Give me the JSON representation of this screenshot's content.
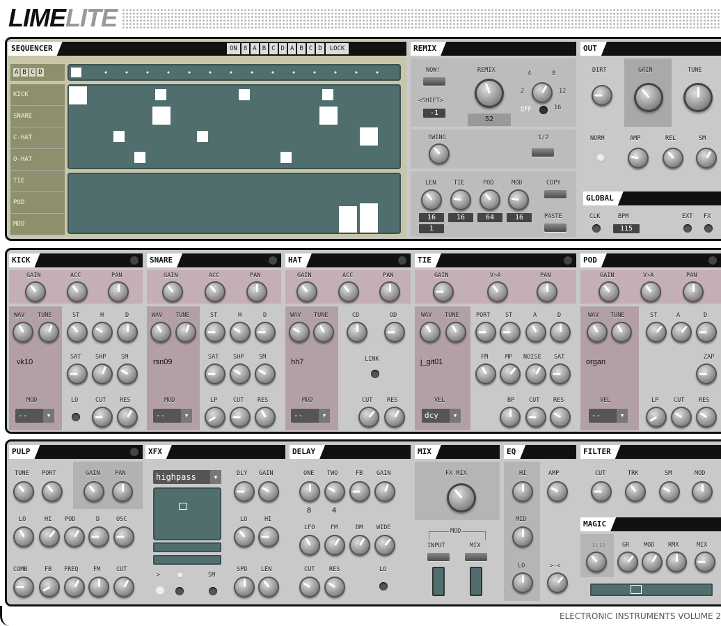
{
  "logo": {
    "lime": "LIME",
    "lite": "LITE"
  },
  "footer": "ELECTRONIC INSTRUMENTS VOLUME 2",
  "sequencer": {
    "title": "SEQUENCER",
    "buttons": [
      "ON",
      "8",
      "A",
      "B",
      "C",
      "D",
      "A",
      "B",
      "C",
      "D",
      "LOCK"
    ],
    "patterns": [
      "A",
      "B",
      "C",
      "D"
    ],
    "rows": [
      "KICK",
      "SNARE",
      "C-HAT",
      "O-HAT",
      "TIE",
      "POD",
      "MOD"
    ]
  },
  "remix": {
    "title": "REMIX",
    "now": "NOW!",
    "shift": "<SHIFT>",
    "shift_val": "-1",
    "remix": "REMIX",
    "remix_val": "52",
    "steps": [
      "4",
      "8",
      "2",
      "12",
      "OFF",
      "16"
    ],
    "swing": "SWING",
    "half": "1/2",
    "len": "LEN",
    "tie": "TIE",
    "pod": "POD",
    "mod": "MOD",
    "copy": "COPY",
    "paste": "PASTE",
    "len_val": "16",
    "tie_val": "16",
    "pod_val": "64",
    "mod_val": "16",
    "len_val2": "1"
  },
  "out": {
    "title": "OUT",
    "dirt": "DIRT",
    "gain": "GAIN",
    "tune": "TUNE",
    "norm": "NORM",
    "amp": "AMP",
    "rel": "REL",
    "sm": "SM"
  },
  "global": {
    "title": "GLOBAL",
    "clk": "CLK",
    "bpm": "BPM",
    "bpm_val": "115",
    "ext": "EXT",
    "fx": "FX"
  },
  "kick": {
    "title": "KICK",
    "gain": "GAIN",
    "acc": "ACC",
    "pan": "PAN",
    "wav": "WAV",
    "tune": "TUNE",
    "st": "ST",
    "h": "H",
    "d": "D",
    "sample": "vk10",
    "sat": "SAT",
    "shp": "SHP",
    "sm": "SM",
    "mod": "MOD",
    "lo": "LO",
    "cut": "CUT",
    "res": "RES",
    "mod_val": "--"
  },
  "snare": {
    "title": "SNARE",
    "gain": "GAIN",
    "acc": "ACC",
    "pan": "PAN",
    "wav": "WAV",
    "tune": "TUNE",
    "st": "ST",
    "h": "H",
    "d": "D",
    "sample": "rsn09",
    "sat": "SAT",
    "shp": "SHP",
    "sm": "SM",
    "mod": "MOD",
    "lp": "LP",
    "cut": "CUT",
    "res": "RES",
    "mod_val": "--"
  },
  "hat": {
    "title": "HAT",
    "gain": "GAIN",
    "acc": "ACC",
    "pan": "PAN",
    "wav": "WAV",
    "tune": "TUNE",
    "cd": "CD",
    "od": "OD",
    "sample": "hh7",
    "link": "LINK",
    "mod": "MOD",
    "cut": "CUT",
    "res": "RES",
    "mod_val": "--"
  },
  "tie": {
    "title": "TIE",
    "gain": "GAIN",
    "vta": "V>A",
    "pan": "PAN",
    "wav": "WAV",
    "tune": "TUNE",
    "port": "PORT",
    "st": "ST",
    "a": "A",
    "d": "D",
    "sample": "j_git01",
    "fm": "FM",
    "mp": "MP",
    "noise": "NOISE",
    "sat": "SAT",
    "vel": "VEL",
    "bp": "BP",
    "cut": "CUT",
    "res": "RES",
    "vel_val": "dcy"
  },
  "pod": {
    "title": "POD",
    "gain": "GAIN",
    "vta": "V>A",
    "pan": "PAN",
    "wav": "WAV",
    "tune": "TUNE",
    "st": "ST",
    "a": "A",
    "d": "D",
    "sample": "organ",
    "zap": "ZAP",
    "vel": "VEL",
    "lp": "LP",
    "cut": "CUT",
    "res": "RES",
    "vel_val": "--"
  },
  "pulp": {
    "title": "PULP",
    "tune": "TUNE",
    "port": "PORT",
    "gain": "GAIN",
    "pan": "PAN",
    "lo": "LO",
    "hi": "HI",
    "pod": "POD",
    "d": "D",
    "osc": "OSC",
    "comb": "COMB",
    "fb": "FB",
    "freq": "FREQ",
    "fm": "FM",
    "cut": "CUT"
  },
  "xfx": {
    "title": "XFX",
    "type": "highpass",
    "dly": "DLY",
    "gain": "GAIN",
    "lo": "LO",
    "hi": "HI",
    "arrow": ">",
    "sm": "SM",
    "spd": "SPD",
    "len": "LEN"
  },
  "delay": {
    "title": "DELAY",
    "one": "ONE",
    "two": "TWO",
    "fb": "FB",
    "gain": "GAIN",
    "one_val": "8",
    "two_val": "4",
    "lfo": "LFO",
    "fm": "FM",
    "dm": "DM",
    "wide": "WIDE",
    "cut": "CUT",
    "res": "RES",
    "lo": "LO"
  },
  "mix": {
    "title": "MIX",
    "fxmix": "FX MIX",
    "mod": "MOD",
    "input": "INPUT",
    "mix": "MIX"
  },
  "eq": {
    "title": "EQ",
    "hi": "HI",
    "amp": "AMP",
    "mid": "MID",
    "lo": "LO",
    "width": ">-<"
  },
  "filter": {
    "title": "FILTER",
    "cut": "CUT",
    "trk": "TRK",
    "sm": "SM",
    "mod": "MOD"
  },
  "magic": {
    "title": "MAGIC",
    "dots": "::::",
    "gr": "GR",
    "mod": "MOD",
    "rmx": "RMX",
    "mix": "MIX"
  }
}
